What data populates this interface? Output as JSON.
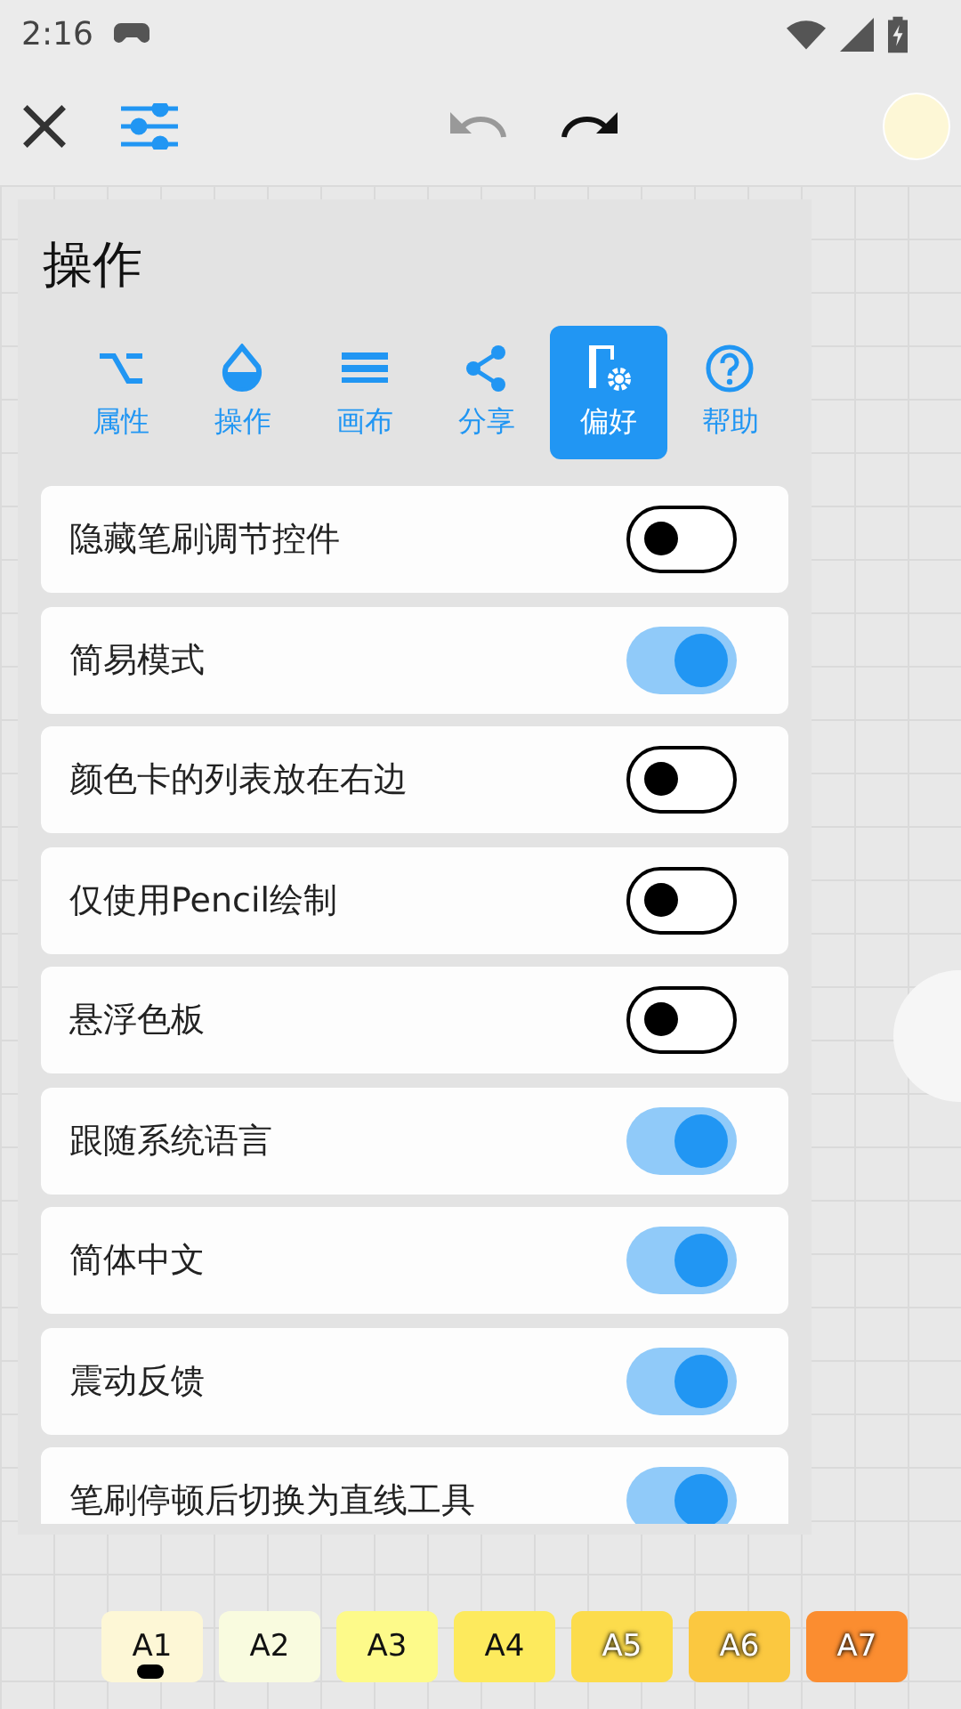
{
  "status_bar": {
    "time": "2:16"
  },
  "panel": {
    "title": "操作",
    "tabs": [
      {
        "label": "属性",
        "kind": "alt",
        "selected": false
      },
      {
        "label": "操作",
        "kind": "drop",
        "selected": false
      },
      {
        "label": "画布",
        "kind": "lines",
        "selected": false
      },
      {
        "label": "分享",
        "kind": "share",
        "selected": false
      },
      {
        "label": "偏好",
        "kind": "prefs",
        "selected": true
      },
      {
        "label": "帮助",
        "kind": "help",
        "selected": false
      }
    ],
    "settings": [
      {
        "label": "隐藏笔刷调节控件",
        "on": false
      },
      {
        "label": "简易模式",
        "on": true
      },
      {
        "label": "颜色卡的列表放在右边",
        "on": false
      },
      {
        "label": "仅使用Pencil绘制",
        "on": false
      },
      {
        "label": "悬浮色板",
        "on": false
      },
      {
        "label": "跟随系统语言",
        "on": true
      },
      {
        "label": "简体中文",
        "on": true
      },
      {
        "label": "震动反馈",
        "on": true
      },
      {
        "label": "笔刷停顿后切换为直线工具",
        "on": true
      }
    ]
  },
  "palette": [
    {
      "label": "A1",
      "color": "#fdf7d6",
      "selected": true
    },
    {
      "label": "A2",
      "color": "#f9fbdf",
      "selected": false
    },
    {
      "label": "A3",
      "color": "#fdfa8a",
      "selected": false
    },
    {
      "label": "A4",
      "color": "#fdea5d",
      "selected": false
    },
    {
      "label": "A5",
      "color": "#fcdc4c",
      "selected": false
    },
    {
      "label": "A6",
      "color": "#fbc840",
      "selected": false
    },
    {
      "label": "A7",
      "color": "#fb8d30",
      "selected": false
    }
  ]
}
